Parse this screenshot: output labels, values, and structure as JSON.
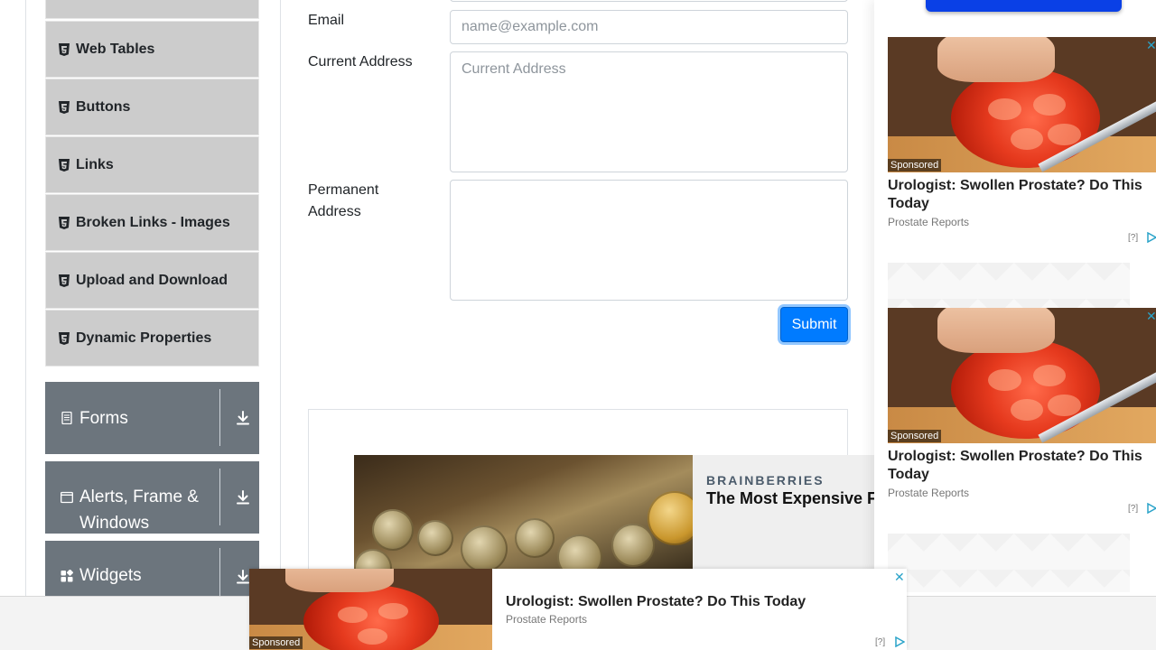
{
  "sidebar": {
    "elements_items": [
      {
        "label": "",
        "icon": "html5-icon"
      },
      {
        "label": "Web Tables",
        "icon": "html5-icon"
      },
      {
        "label": "Buttons",
        "icon": "html5-icon"
      },
      {
        "label": "Links",
        "icon": "html5-icon"
      },
      {
        "label": "Broken Links - Images",
        "icon": "html5-icon"
      },
      {
        "label": "Upload and Download",
        "icon": "html5-icon"
      },
      {
        "label": "Dynamic Properties",
        "icon": "html5-icon"
      }
    ],
    "groups": [
      {
        "label": "Forms",
        "icon": "document-icon"
      },
      {
        "label": "Alerts, Frame & Windows",
        "icon": "window-icon"
      },
      {
        "label": "Widgets",
        "icon": "widgets-icon"
      }
    ]
  },
  "form": {
    "email_label": "Email",
    "email_placeholder": "name@example.com",
    "current_address_label": "Current Address",
    "current_address_placeholder": "Current Address",
    "permanent_address_label": "Permanent Address",
    "permanent_address_value": "",
    "submit_label": "Submit"
  },
  "article_ad": {
    "brand": "BRAINBERRIES",
    "title": "The Most Expensive F"
  },
  "side_ads": [
    {
      "title": "Urologist: Swollen Prostate? Do This Today",
      "source": "Prostate Reports",
      "sponsored": "Sponsored",
      "help": "[?]"
    },
    {
      "title": "Urologist: Swollen Prostate? Do This Today",
      "source": "Prostate Reports",
      "sponsored": "Sponsored",
      "help": "[?]"
    }
  ],
  "bottom_ad": {
    "title": "Urologist: Swollen Prostate? Do This Today",
    "source": "Prostate Reports",
    "sponsored": "Sponsored",
    "help": "[?]"
  },
  "colors": {
    "submit_blue": "#007bff",
    "group_gray": "#6c757d",
    "subitem_gray": "#cccccc",
    "close_teal": "#2aa3c9"
  }
}
